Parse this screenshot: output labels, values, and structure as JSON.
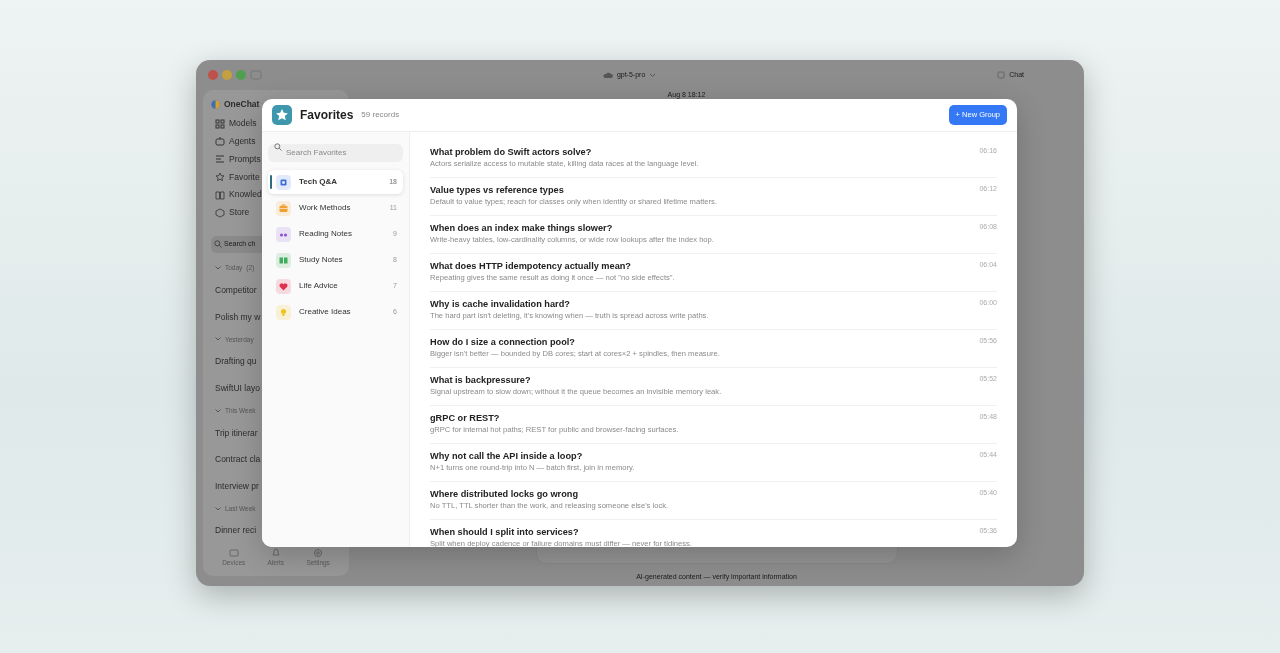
{
  "window": {
    "model": "gpt-5-pro",
    "top_button": "Chat",
    "timestamp": "Aug 8 18:12",
    "footer": "AI-generated content — verify important information"
  },
  "app_sidebar": {
    "app_name": "OneChat",
    "nav": [
      {
        "label": "Models"
      },
      {
        "label": "Agents"
      },
      {
        "label": "Prompts"
      },
      {
        "label": "Favorite"
      },
      {
        "label": "Knowled"
      },
      {
        "label": "Store"
      }
    ],
    "search_placeholder": "Search ch",
    "groups": [
      {
        "label": "Today",
        "count": "(2)",
        "items": [
          "Competitor",
          "Polish my w"
        ]
      },
      {
        "label": "Yesterday",
        "items": [
          "Drafting qu",
          "SwiftUI layo"
        ]
      },
      {
        "label": "This Week",
        "items": [
          "Trip itinerar",
          "Contract cla",
          "Interview pr"
        ]
      },
      {
        "label": "Last Week",
        "items": [
          "Dinner reci"
        ]
      }
    ],
    "bottom_tabs": [
      "Devices",
      "Alerts",
      "Settings"
    ]
  },
  "favorites": {
    "title": "Favorites",
    "record_count": "59 records",
    "new_group_button": "+ New Group",
    "search": {
      "placeholder": "Search Favorites"
    },
    "groups": [
      {
        "label": "Tech Q&A",
        "count": "18",
        "color": "#3b6fd8",
        "selected": true
      },
      {
        "label": "Work Methods",
        "count": "11",
        "color": "#f0a030",
        "selected": false
      },
      {
        "label": "Reading Notes",
        "count": "9",
        "color": "#8a55d8",
        "selected": false
      },
      {
        "label": "Study Notes",
        "count": "8",
        "color": "#3fae5a",
        "selected": false
      },
      {
        "label": "Life Advice",
        "count": "7",
        "color": "#e0304a",
        "selected": false
      },
      {
        "label": "Creative Ideas",
        "count": "6",
        "color": "#f2c418",
        "selected": false
      }
    ],
    "records": [
      {
        "title": "What problem do Swift actors solve?",
        "summary": "Actors serialize access to mutable state, killing data races at the language level.",
        "time": "06:16"
      },
      {
        "title": "Value types vs reference types",
        "summary": "Default to value types; reach for classes only when identity or shared lifetime matters.",
        "time": "06:12"
      },
      {
        "title": "When does an index make things slower?",
        "summary": "Write-heavy tables, low-cardinality columns, or wide row lookups after the index hop.",
        "time": "06:08"
      },
      {
        "title": "What does HTTP idempotency actually mean?",
        "summary": "Repeating gives the same result as doing it once — not \"no side effects\".",
        "time": "06:04"
      },
      {
        "title": "Why is cache invalidation hard?",
        "summary": "The hard part isn't deleting, it's knowing when — truth is spread across write paths.",
        "time": "06:00"
      },
      {
        "title": "How do I size a connection pool?",
        "summary": "Bigger isn't better — bounded by DB cores; start at cores×2 + spindles, then measure.",
        "time": "05:56"
      },
      {
        "title": "What is backpressure?",
        "summary": "Signal upstream to slow down; without it the queue becomes an invisible memory leak.",
        "time": "05:52"
      },
      {
        "title": "gRPC or REST?",
        "summary": "gRPC for internal hot paths; REST for public and browser-facing surfaces.",
        "time": "05:48"
      },
      {
        "title": "Why not call the API inside a loop?",
        "summary": "N+1 turns one round-trip into N — batch first, join in memory.",
        "time": "05:44"
      },
      {
        "title": "Where distributed locks go wrong",
        "summary": "No TTL, TTL shorter than the work, and releasing someone else's lock.",
        "time": "05:40"
      },
      {
        "title": "When should I split into services?",
        "summary": "Split when deploy cadence or failure domains must differ — never for tidiness.",
        "time": "05:36"
      }
    ]
  }
}
